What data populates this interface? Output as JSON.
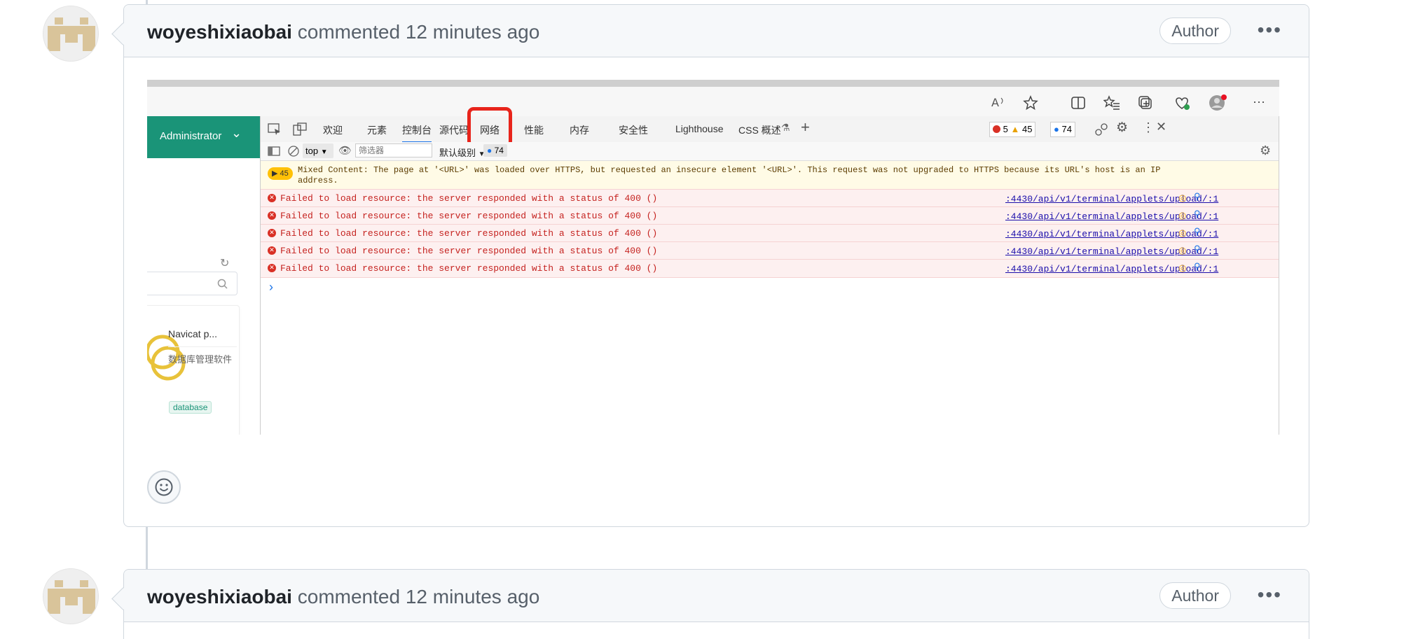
{
  "comments": [
    {
      "username": "woyeshixiaobai",
      "action": "commented 12 minutes ago",
      "badge": "Author",
      "more_label": "•••"
    },
    {
      "username": "woyeshixiaobai",
      "action": "commented 12 minutes ago",
      "badge": "Author",
      "more_label": "•••"
    }
  ],
  "screenshot": {
    "browser_more": "···",
    "sidebar": {
      "user_menu": "Administrator",
      "card_title": "Navicat p...",
      "card_desc": "数据库管理软件",
      "card_tag": "database"
    },
    "devtools": {
      "tabs": [
        "欢迎",
        "元素",
        "控制台",
        "源代码",
        "网络",
        "性能",
        "内存",
        "安全性",
        "Lighthouse",
        "CSS 概述"
      ],
      "active_tab": "控制台",
      "highlighted_tab": "网络",
      "errors_count": "5",
      "warnings_count": "45",
      "info_count": "74",
      "context": "top",
      "filter_placeholder": "筛选器",
      "level": "默认级别",
      "issues_count": "74",
      "warning_badge": "45",
      "warning_message_line1": "Mixed Content: The page at '<URL>' was loaded over HTTPS, but requested an insecure element '<URL>'. This request was not upgraded to HTTPS because its URL's host is an IP",
      "warning_message_line2": "address.",
      "errors": [
        {
          "message": "Failed to load resource: the server responded with a status of 400 ()",
          "source": ":4430/api/v1/terminal/applets/upload/:1"
        },
        {
          "message": "Failed to load resource: the server responded with a status of 400 ()",
          "source": ":4430/api/v1/terminal/applets/upload/:1"
        },
        {
          "message": "Failed to load resource: the server responded with a status of 400 ()",
          "source": ":4430/api/v1/terminal/applets/upload/:1"
        },
        {
          "message": "Failed to load resource: the server responded with a status of 400 ()",
          "source": ":4430/api/v1/terminal/applets/upload/:1"
        },
        {
          "message": "Failed to load resource: the server responded with a status of 400 ()",
          "source": ":4430/api/v1/terminal/applets/upload/:1"
        }
      ],
      "prompt": "›"
    }
  },
  "colors": {
    "accent_green": "#1a9478",
    "highlight_red": "#e8241b",
    "error_bg": "#fdf0f0",
    "warning_bg": "#fffbe6"
  }
}
